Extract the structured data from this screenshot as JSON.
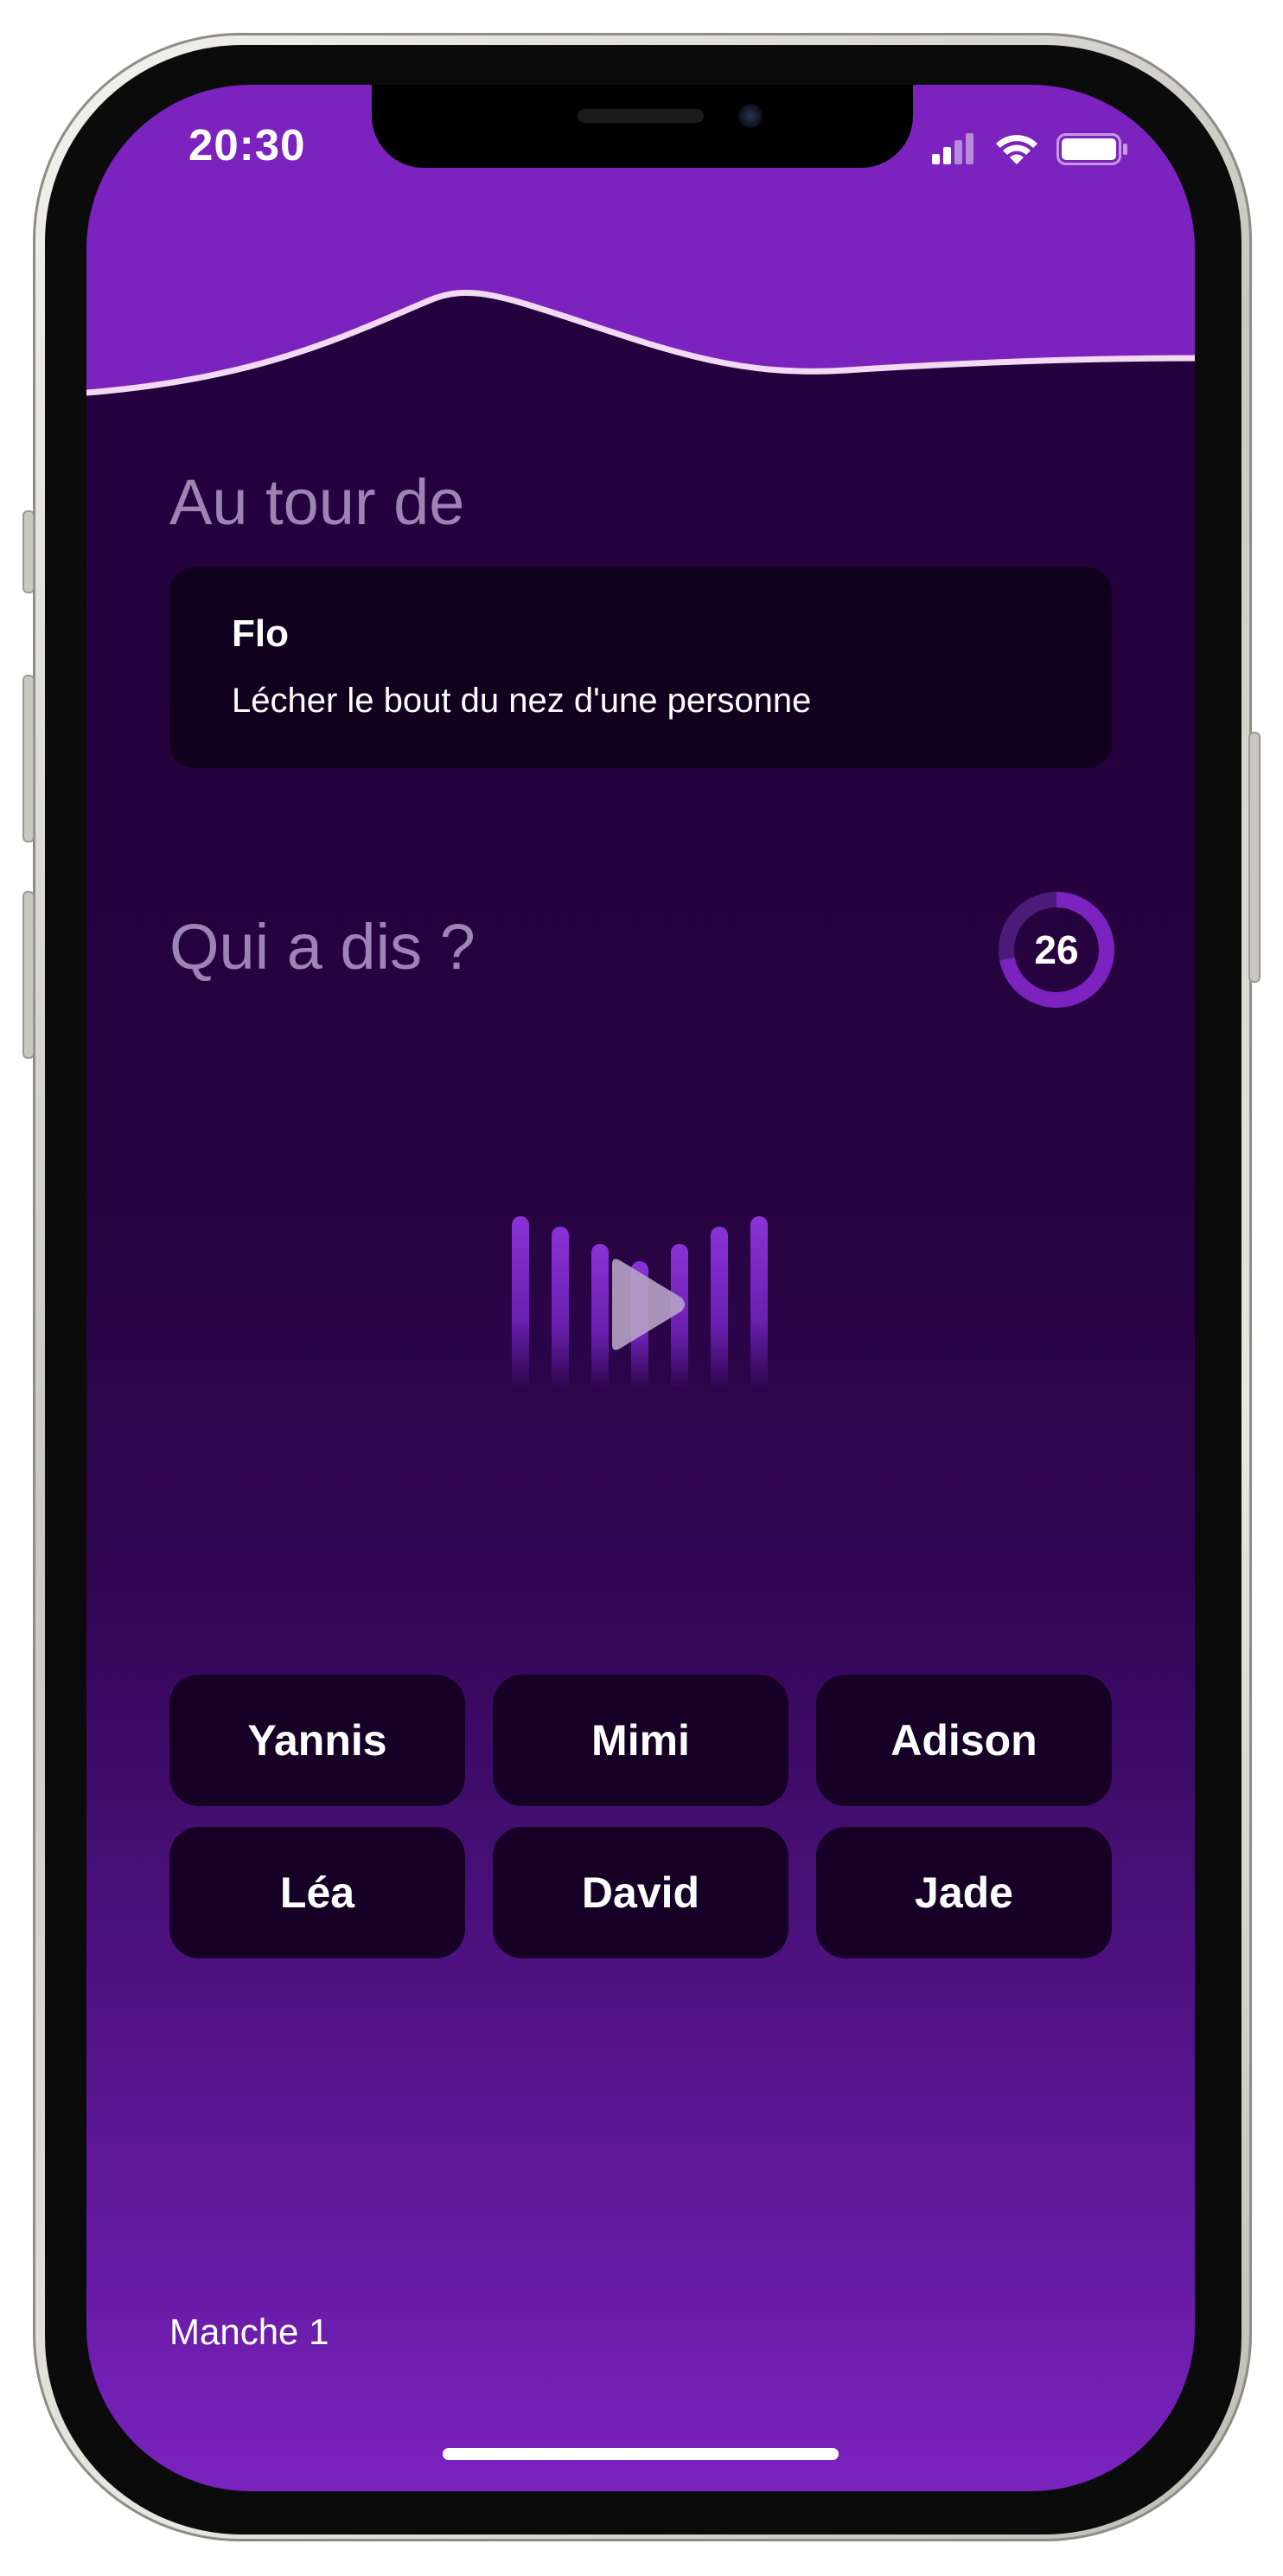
{
  "status_bar": {
    "time": "20:30",
    "icons": [
      "cellular-signal-icon",
      "wifi-icon",
      "battery-icon"
    ]
  },
  "turn_section": {
    "title": "Au tour de",
    "player_name": "Flo",
    "challenge": "Lécher le bout du nez d'une personne"
  },
  "question_section": {
    "title": "Qui a dis ?",
    "timer_value": "26",
    "timer_progress": 0.72
  },
  "audio_player": {
    "icon": "play-icon",
    "bars": 7
  },
  "answers": [
    "Yannis",
    "Mimi",
    "Adison",
    "Léa",
    "David",
    "Jade"
  ],
  "footer": {
    "round": "Manche 1"
  },
  "colors": {
    "accent": "#7b22bf",
    "background": "#23003d",
    "card": "#12001f",
    "button": "#160025",
    "title_muted": "#9e84b5"
  }
}
